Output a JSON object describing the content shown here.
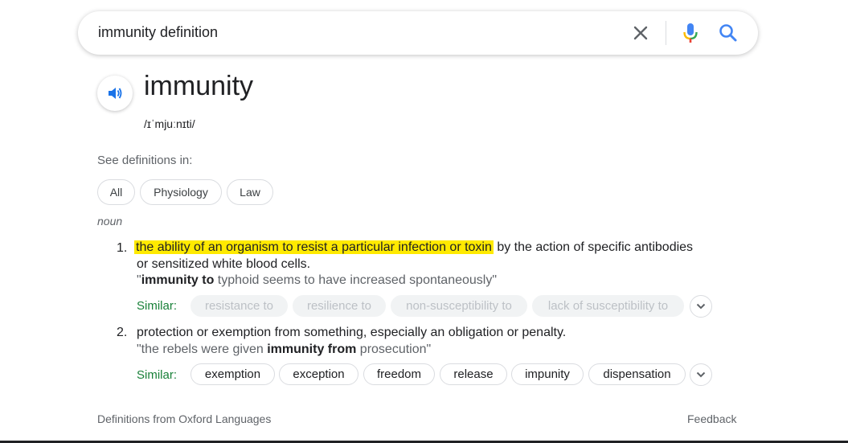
{
  "search": {
    "query": "immunity definition"
  },
  "entry": {
    "word": "immunity",
    "phonetic": "/ɪˈmjuːnɪti/",
    "see_definitions_label": "See definitions in:",
    "filters": [
      "All",
      "Physiology",
      "Law"
    ],
    "part_of_speech": "noun"
  },
  "definitions": [
    {
      "number": "1.",
      "highlighted": "the ability of an organism to resist a particular infection or toxin",
      "rest": " by the action of specific antibodies",
      "line2": "or sensitized white blood cells.",
      "example_open": "\"",
      "example_bold": "immunity to",
      "example_rest": " typhoid seems to have increased spontaneously\"",
      "similar_label": "Similar:",
      "synonyms": [
        "resistance to",
        "resilience to",
        "non-susceptibility to",
        "lack of susceptibility to"
      ]
    },
    {
      "number": "2.",
      "text": "protection or exemption from something, especially an obligation or penalty.",
      "example_open": "\"the rebels were given ",
      "example_bold": "immunity from",
      "example_rest": " prosecution\"",
      "similar_label": "Similar:",
      "synonyms": [
        "exemption",
        "exception",
        "freedom",
        "release",
        "impunity",
        "dispensation"
      ]
    }
  ],
  "footer": {
    "source": "Definitions from Oxford Languages",
    "feedback": "Feedback"
  },
  "icons": {
    "clear": "close-icon",
    "mic": "microphone-icon",
    "search": "search-icon",
    "speaker": "speaker-icon",
    "expand": "chevron-down-icon"
  },
  "colors": {
    "highlight": "#ffea00",
    "similar_label": "#188038",
    "search_blue": "#4285f4"
  }
}
